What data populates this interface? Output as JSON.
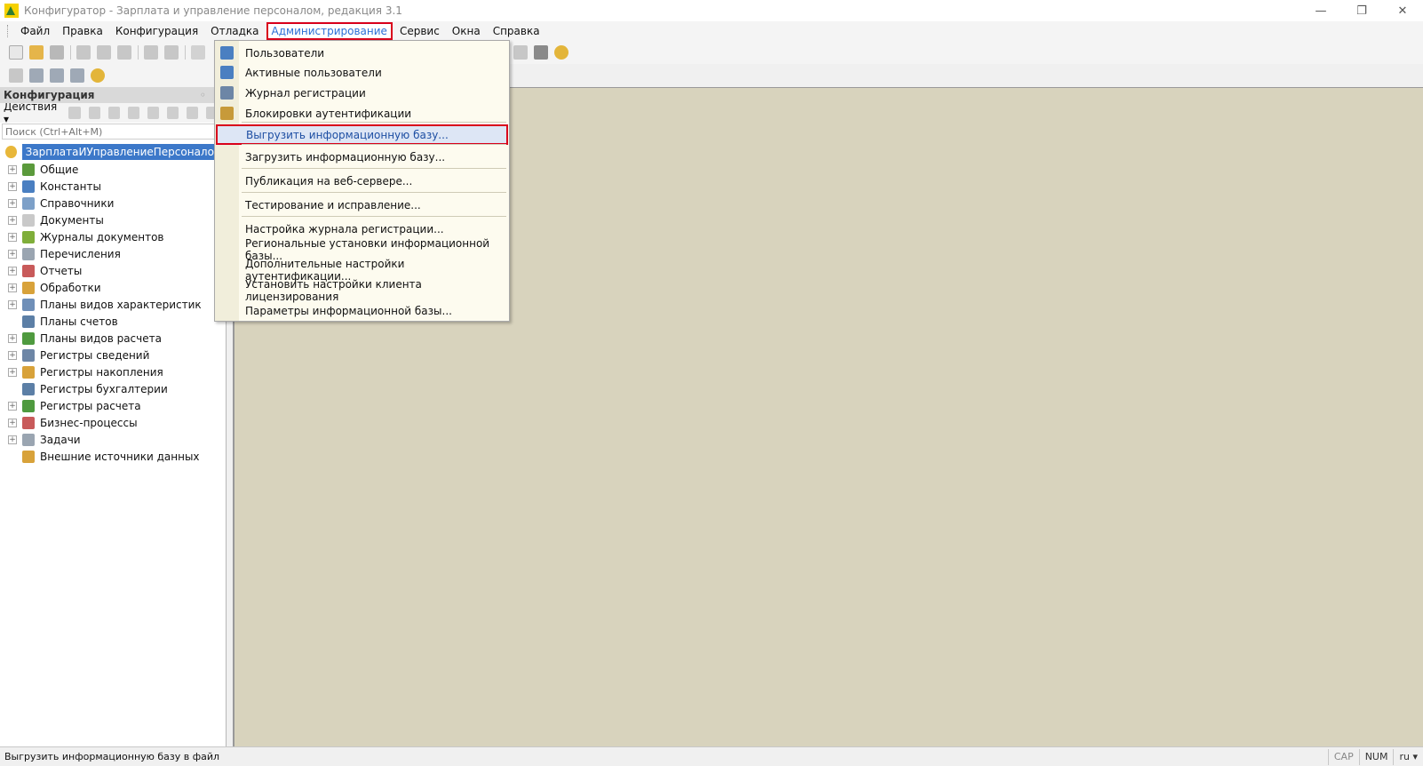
{
  "window": {
    "title": "Конфигуратор - Зарплата и управление персоналом, редакция 3.1",
    "controls": {
      "minimize": "—",
      "restore": "❐",
      "close": "✕"
    }
  },
  "menubar": {
    "items": [
      {
        "label": "Файл",
        "name": "menu-file"
      },
      {
        "label": "Правка",
        "name": "menu-edit"
      },
      {
        "label": "Конфигурация",
        "name": "menu-configuration"
      },
      {
        "label": "Отладка",
        "name": "menu-debug"
      },
      {
        "label": "Администрирование",
        "name": "menu-administration",
        "active": true
      },
      {
        "label": "Сервис",
        "name": "menu-service"
      },
      {
        "label": "Окна",
        "name": "menu-windows"
      },
      {
        "label": "Справка",
        "name": "menu-help"
      }
    ]
  },
  "left_panel": {
    "header": "Конфигурация",
    "pin": "◦",
    "actions_label": "Действия ▾",
    "search_placeholder": "Поиск (Ctrl+Alt+M)",
    "root": "ЗарплатаИУправлениеПерсоналом",
    "items": [
      {
        "label": "Общие",
        "expandable": true,
        "color": "#5b9a3c"
      },
      {
        "label": "Константы",
        "expandable": true,
        "color": "#4a7fc1"
      },
      {
        "label": "Справочники",
        "expandable": true,
        "color": "#7da0c8"
      },
      {
        "label": "Документы",
        "expandable": true,
        "color": "#c9c9c9"
      },
      {
        "label": "Журналы документов",
        "expandable": true,
        "color": "#7fae3a"
      },
      {
        "label": "Перечисления",
        "expandable": true,
        "color": "#9aa5b1"
      },
      {
        "label": "Отчеты",
        "expandable": true,
        "color": "#c85a5a"
      },
      {
        "label": "Обработки",
        "expandable": true,
        "color": "#d8a23a"
      },
      {
        "label": "Планы видов характеристик",
        "expandable": true,
        "color": "#6f8fb8"
      },
      {
        "label": "Планы счетов",
        "expandable": false,
        "color": "#5c7fa6"
      },
      {
        "label": "Планы видов расчета",
        "expandable": true,
        "color": "#4f9a3f"
      },
      {
        "label": "Регистры сведений",
        "expandable": true,
        "color": "#6d86a6"
      },
      {
        "label": "Регистры накопления",
        "expandable": true,
        "color": "#d8a23a"
      },
      {
        "label": "Регистры бухгалтерии",
        "expandable": false,
        "color": "#5c7fa6"
      },
      {
        "label": "Регистры расчета",
        "expandable": true,
        "color": "#4f9a3f"
      },
      {
        "label": "Бизнес-процессы",
        "expandable": true,
        "color": "#c85a5a"
      },
      {
        "label": "Задачи",
        "expandable": true,
        "color": "#9aa5b1"
      },
      {
        "label": "Внешние источники данных",
        "expandable": false,
        "color": "#d8a23a"
      }
    ]
  },
  "dropdown": {
    "items": [
      {
        "label": "Пользователи",
        "name": "menu-users",
        "icon": "user-icon",
        "color": "#4a7fc1"
      },
      {
        "label": "Активные пользователи",
        "name": "menu-active-users",
        "icon": "active-users-icon",
        "color": "#4a7fc1"
      },
      {
        "label": "Журнал регистрации",
        "name": "menu-event-log",
        "icon": "log-icon",
        "color": "#6d86a6"
      },
      {
        "label": "Блокировки аутентификации",
        "name": "menu-auth-locks",
        "icon": "lock-user-icon",
        "color": "#c79a3a"
      },
      {
        "label": "Выгрузить информационную базу...",
        "name": "menu-dump-infobase",
        "selected": true
      },
      {
        "label": "Загрузить информационную базу...",
        "name": "menu-load-infobase"
      },
      {
        "label": "Публикация на веб-сервере...",
        "name": "menu-web-publish"
      },
      {
        "label": "Тестирование и исправление...",
        "name": "menu-test-repair"
      },
      {
        "label": "Настройка журнала регистрации...",
        "name": "menu-event-log-settings"
      },
      {
        "label": "Региональные установки информационной базы...",
        "name": "menu-regional-settings"
      },
      {
        "label": "Дополнительные настройки аутентификации...",
        "name": "menu-auth-settings"
      },
      {
        "label": "Установить настройки клиента лицензирования",
        "name": "menu-license-client"
      },
      {
        "label": "Параметры информационной базы...",
        "name": "menu-infobase-params"
      }
    ]
  },
  "statusbar": {
    "message": "Выгрузить информационную базу в файл",
    "cap": "CAP",
    "num": "NUM",
    "lang": "ru ▾"
  },
  "colors": {
    "accent_red": "#d9001b",
    "selection_blue": "#3c78c9",
    "main_area": "#d8d3bd"
  }
}
